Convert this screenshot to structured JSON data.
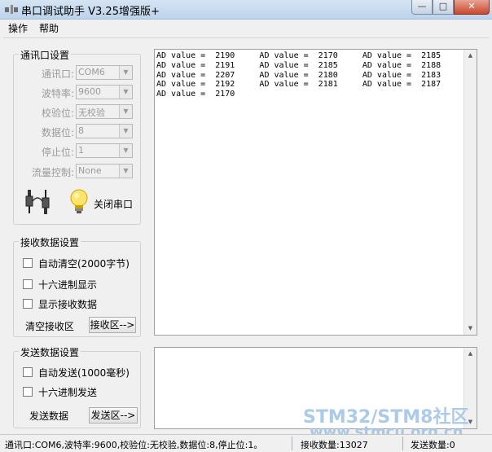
{
  "window": {
    "title": "串口调试助手 V3.25增强版+",
    "app_icon": "plug-app-icon",
    "min_label": "—",
    "max_label": "□",
    "close_label": "✕"
  },
  "menu": [
    "操作",
    "帮助"
  ],
  "port_settings": {
    "legend": "通讯口设置",
    "port_label": "通讯口:",
    "port_value": "COM6",
    "baud_label": "波特率:",
    "baud_value": "9600",
    "parity_label": "校验位:",
    "parity_value": "无校验",
    "databits_label": "数据位:",
    "databits_value": "8",
    "stopbits_label": "停止位:",
    "stopbits_value": "1",
    "flow_label": "流量控制:",
    "flow_value": "None",
    "connector_icon": "serial-connector-icon",
    "bulb_icon": "light-bulb-icon",
    "close_port_label": "关闭串口"
  },
  "receive_settings": {
    "legend": "接收数据设置",
    "auto_clear": "自动清空(2000字节)",
    "hex_display": "十六进制显示",
    "show_received": "显示接收数据",
    "clear_area": "清空接收区",
    "recv_area_btn": "接收区-->"
  },
  "send_settings": {
    "legend": "发送数据设置",
    "auto_send": "自动发送(1000毫秒)",
    "hex_send": "十六进制发送",
    "send_data": "发送数据",
    "send_area_btn": "发送区-->"
  },
  "receive_area": {
    "lines": [
      "AD value =  2190     AD value =  2170     AD value =  2185",
      "AD value =  2191     AD value =  2185     AD value =  2188",
      "AD value =  2207     AD value =  2180     AD value =  2183",
      "AD value =  2192     AD value =  2181     AD value =  2187",
      "AD value =  2170"
    ]
  },
  "status": {
    "port_info": "通讯口:COM6,波特率:9600,校验位:无校验,数据位:8,停止位:1。",
    "rx_count": "接收数量:13027",
    "tx_count": "发送数量:0"
  },
  "watermark": {
    "line1": "STM32/STM8社区",
    "line2": "www.stmcu.org.cn"
  }
}
